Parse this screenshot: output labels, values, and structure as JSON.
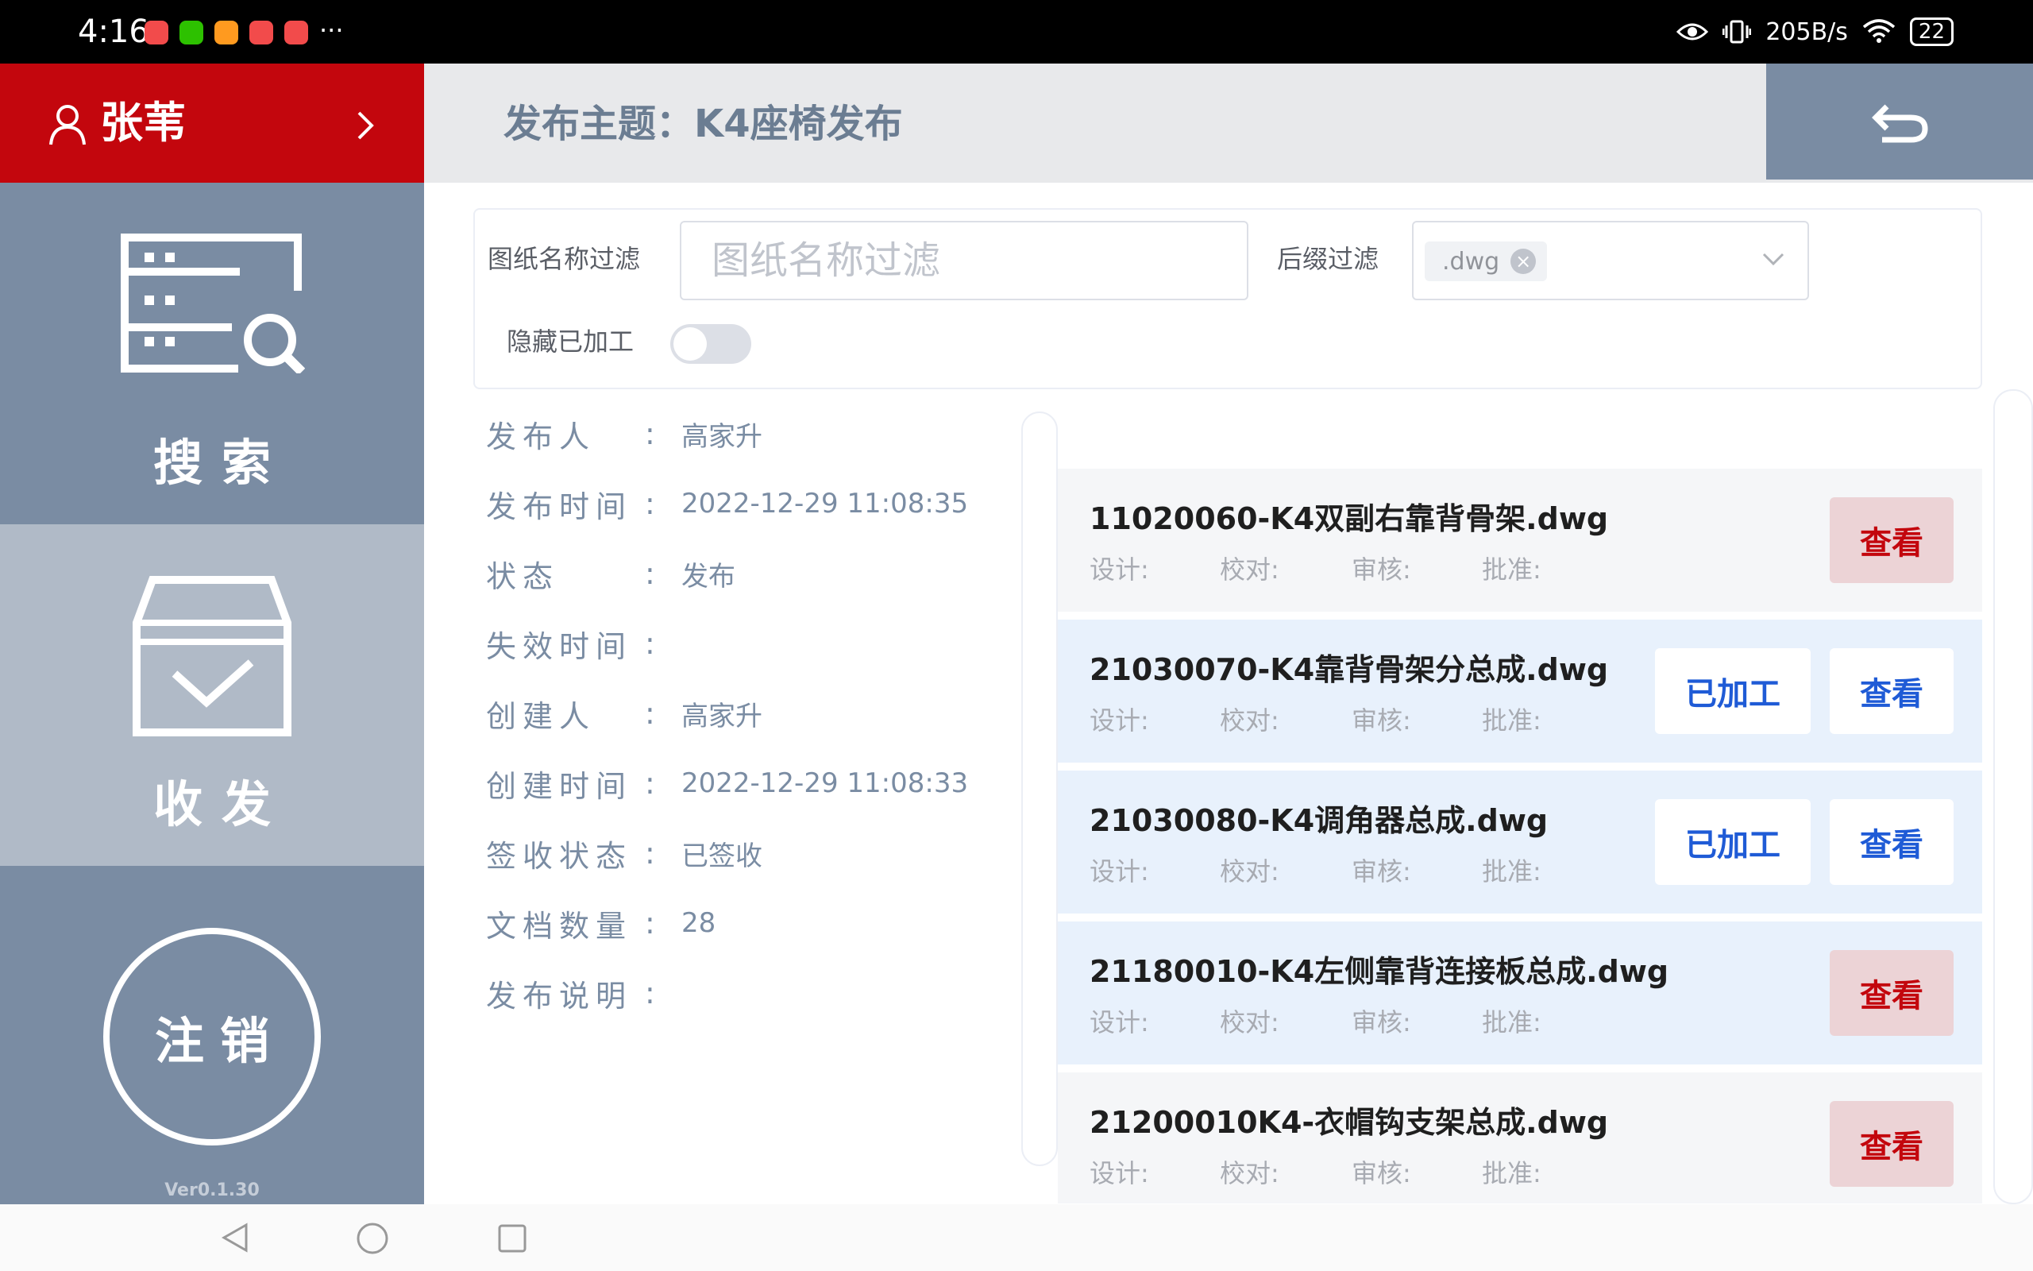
{
  "status_bar": {
    "time": "4:16",
    "more": "···",
    "net_speed": "205B/s",
    "battery": "22",
    "notification_icons": [
      {
        "name": "red-app-icon",
        "color": "#f24b4b"
      },
      {
        "name": "wechat-icon",
        "color": "#2dc100"
      },
      {
        "name": "orange-app-icon",
        "color": "#ff9a1f"
      },
      {
        "name": "weibo-icon",
        "color": "#f24b4b"
      },
      {
        "name": "red-app-icon-2",
        "color": "#f24b4b"
      }
    ]
  },
  "sidebar": {
    "user_name": "张苇",
    "nav_search_label": "搜索",
    "nav_transfer_label": "收发",
    "logout_label": "注销",
    "version": "Ver0.1.30"
  },
  "header": {
    "title": "发布主题：K4座椅发布"
  },
  "filter": {
    "name_label": "图纸名称过滤",
    "name_placeholder": "图纸名称过滤",
    "suffix_label": "后缀过滤",
    "suffix_tag": ".dwg",
    "hide_label": "隐藏已加工",
    "hide_enabled": false
  },
  "details": [
    {
      "label": "发布人",
      "value": "高家升"
    },
    {
      "label": "发布时间",
      "value": "2022-12-29 11:08:35"
    },
    {
      "label": "状态",
      "value": "发布"
    },
    {
      "label": "失效时间",
      "value": ""
    },
    {
      "label": "创建人",
      "value": "高家升"
    },
    {
      "label": "创建时间",
      "value": "2022-12-29 11:08:33"
    },
    {
      "label": "签收状态",
      "value": "已签收"
    },
    {
      "label": "文档数量",
      "value": "28"
    },
    {
      "label": "发布说明",
      "value": ""
    }
  ],
  "meta_labels": {
    "design": "设计:",
    "check": "校对:",
    "review": "审核:",
    "approve": "批准:"
  },
  "buttons": {
    "view": "查看",
    "processed": "已加工"
  },
  "files": [
    {
      "name": "11020060-K4双副右靠背骨架.dwg",
      "processed": false
    },
    {
      "name": "21030070-K4靠背骨架分总成.dwg",
      "processed": true
    },
    {
      "name": "21030080-K4调角器总成.dwg",
      "processed": true
    },
    {
      "name": "21180010-K4左侧靠背连接板总成.dwg",
      "processed": false
    },
    {
      "name": "21200010K4-衣帽钩支架总成.dwg",
      "processed": false
    }
  ],
  "colors": {
    "brand_red": "#c3060d",
    "sidebar_slate": "#7a8ca3",
    "sidebar_active": "#b0bac7",
    "view_unprocessed_bg": "#ecd3d6",
    "view_unprocessed_text": "#c3060d",
    "view_processed_text": "#1f5bd6",
    "row_processed_bg": "#e8f1fc",
    "row_default_bg": "#f5f6f8"
  }
}
